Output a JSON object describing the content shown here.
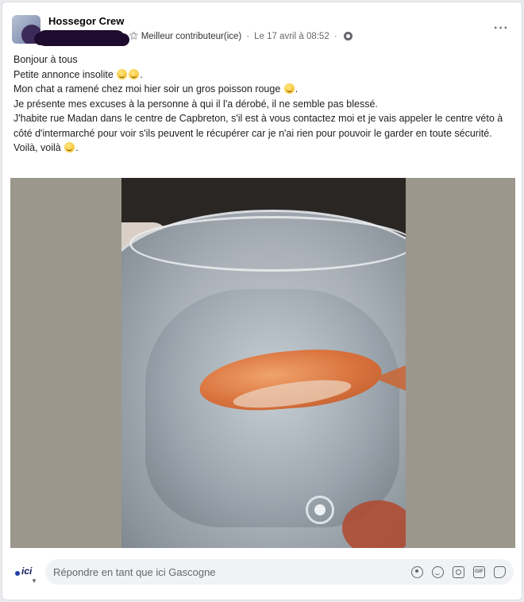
{
  "post": {
    "group_name": "Hossegor Crew",
    "badge_text": "Meilleur contributeur(ice)",
    "meta_separator": "·",
    "date": "Le 17 avril à 08:52",
    "more_label": "···",
    "lines": [
      "Bonjour à tous",
      "Petite annonce insolite",
      "Mon chat a ramené chez moi hier soir un gros poisson rouge",
      "Je présente mes excuses à la personne à qui il l'a dérobé, il ne semble pas blessé.",
      "J'habite rue Madan dans le centre de Capbreton, s'il est à vous contactez moi et je vais appeler le centre véto à côté d'intermarché pour voir s'ils peuvent le récupérer car je n'ai rien pour pouvoir le garder en toute sécurité.",
      "Voilà, voilà"
    ]
  },
  "comment": {
    "avatar_label": "ici",
    "placeholder": "Répondre en tant que ici Gascogne",
    "gif_label": "GIF"
  },
  "icons": {
    "badge": "contributor-badge-icon",
    "privacy": "globe-icon",
    "more": "more-options-icon"
  }
}
